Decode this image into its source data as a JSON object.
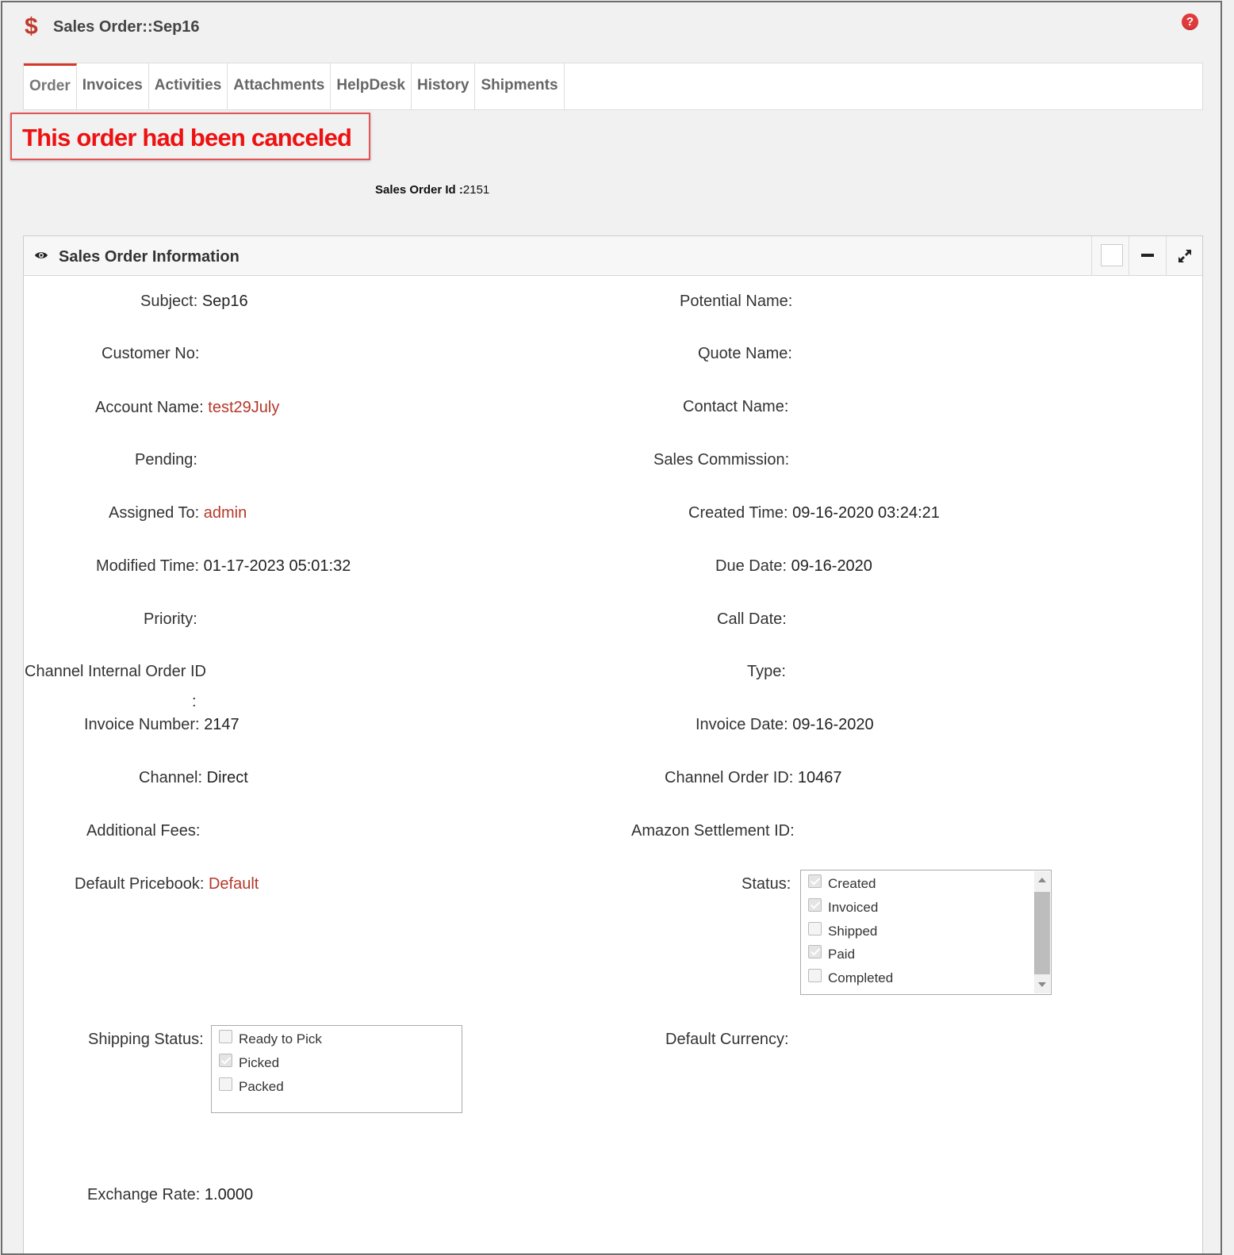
{
  "window": {
    "title": "Sales Order::Sep16",
    "help_glyph": "?"
  },
  "tabs": [
    {
      "label": "Order",
      "active": true
    },
    {
      "label": "Invoices"
    },
    {
      "label": "Activities"
    },
    {
      "label": "Attachments"
    },
    {
      "label": "HelpDesk"
    },
    {
      "label": "History"
    },
    {
      "label": "Shipments"
    }
  ],
  "notice": {
    "text": "This order had been canceled",
    "color": "#ee1111"
  },
  "order_id": {
    "label": "Sales Order Id",
    "sep": ":",
    "value": "2151"
  },
  "panel": {
    "title": "Sales Order Information"
  },
  "fields": {
    "subject": {
      "label": "Subject:",
      "value": "Sep16"
    },
    "potential_name": {
      "label": "Potential Name:",
      "value": ""
    },
    "customer_no": {
      "label": "Customer No:",
      "value": ""
    },
    "quote_name": {
      "label": "Quote Name:",
      "value": ""
    },
    "account_name": {
      "label": "Account Name:",
      "value": "test29July"
    },
    "contact_name": {
      "label": "Contact Name:",
      "value": ""
    },
    "pending": {
      "label": "Pending:",
      "value": ""
    },
    "sales_commission": {
      "label": "Sales Commission:",
      "value": ""
    },
    "assigned_to": {
      "label": "Assigned To:",
      "value": "admin"
    },
    "created_time": {
      "label": "Created Time:",
      "value": "09-16-2020 03:24:21"
    },
    "modified_time": {
      "label": "Modified Time:",
      "value": "01-17-2023 05:01:32"
    },
    "due_date": {
      "label": "Due Date:",
      "value": "09-16-2020"
    },
    "priority": {
      "label": "Priority:",
      "value": ""
    },
    "call_date": {
      "label": "Call Date:",
      "value": ""
    },
    "channel_internal_order_id": {
      "label": "Channel Internal Order ID",
      "colon": ":",
      "value": ""
    },
    "type": {
      "label": "Type:",
      "value": ""
    },
    "invoice_number": {
      "label": "Invoice Number:",
      "value": "2147"
    },
    "invoice_date": {
      "label": "Invoice Date:",
      "value": "09-16-2020"
    },
    "channel": {
      "label": "Channel:",
      "value": "Direct"
    },
    "channel_order_id": {
      "label": "Channel Order ID:",
      "value": "10467"
    },
    "additional_fees": {
      "label": "Additional Fees:",
      "value": ""
    },
    "amazon_settlement_id": {
      "label": "Amazon Settlement ID:",
      "value": ""
    },
    "default_pricebook": {
      "label": "Default Pricebook:",
      "value": "Default"
    },
    "status": {
      "label": "Status:"
    },
    "shipping_status": {
      "label": "Shipping Status:"
    },
    "default_currency": {
      "label": "Default Currency:",
      "value": ""
    },
    "exchange_rate": {
      "label": "Exchange Rate:",
      "value": "1.0000"
    }
  },
  "status_options": [
    {
      "label": "Created",
      "checked": true
    },
    {
      "label": "Invoiced",
      "checked": true
    },
    {
      "label": "Shipped",
      "checked": false
    },
    {
      "label": "Paid",
      "checked": true
    },
    {
      "label": "Completed",
      "checked": false
    }
  ],
  "shipping_options": [
    {
      "label": "Ready to Pick",
      "checked": false
    },
    {
      "label": "Picked",
      "checked": true
    },
    {
      "label": "Packed",
      "checked": false
    }
  ],
  "colors": {
    "accent": "#d23b2b",
    "link": "#b5382a",
    "dollar": "#c0392b"
  }
}
